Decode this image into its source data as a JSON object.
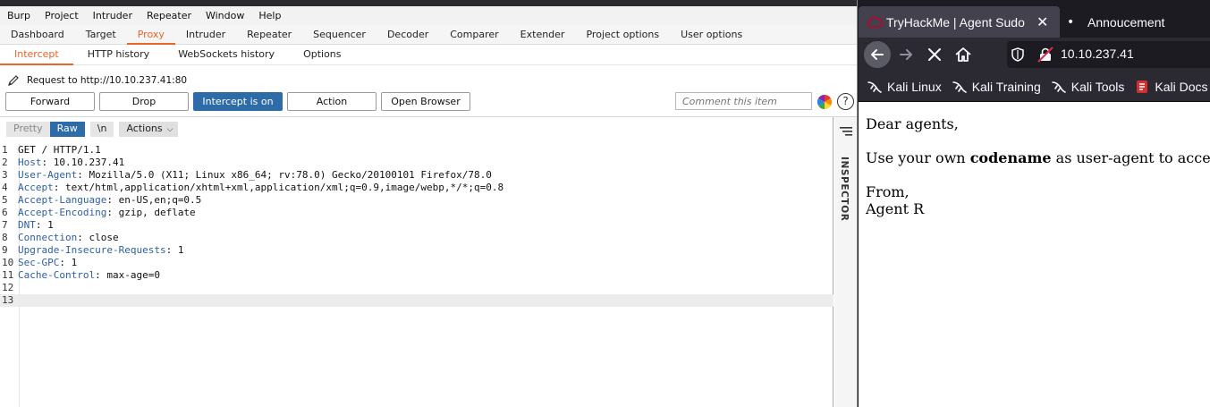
{
  "burp": {
    "menu": [
      "Burp",
      "Project",
      "Intruder",
      "Repeater",
      "Window",
      "Help"
    ],
    "main_tabs": [
      "Dashboard",
      "Target",
      "Proxy",
      "Intruder",
      "Repeater",
      "Sequencer",
      "Decoder",
      "Comparer",
      "Extender",
      "Project options",
      "User options"
    ],
    "active_main_tab": "Proxy",
    "proxy_tabs": [
      "Intercept",
      "HTTP history",
      "WebSockets history",
      "Options"
    ],
    "active_proxy_tab": "Intercept",
    "request_info": "Request to http://10.10.237.41:80",
    "buttons": {
      "forward": "Forward",
      "drop": "Drop",
      "intercept": "Intercept is on",
      "action": "Action",
      "open_browser": "Open Browser"
    },
    "comment_placeholder": "Comment this item",
    "help": "?",
    "editor_toolbar": {
      "pretty": "Pretty",
      "raw": "Raw",
      "newline": "\\n",
      "actions": "Actions"
    },
    "request_lines": [
      {
        "num": "1",
        "name": "",
        "text": "GET / HTTP/1.1"
      },
      {
        "num": "2",
        "name": "Host",
        "text": ": 10.10.237.41"
      },
      {
        "num": "3",
        "name": "User-Agent",
        "text": ": Mozilla/5.0 (X11; Linux x86_64; rv:78.0) Gecko/20100101 Firefox/78.0"
      },
      {
        "num": "4",
        "name": "Accept",
        "text": ": text/html,application/xhtml+xml,application/xml;q=0.9,image/webp,*/*;q=0.8"
      },
      {
        "num": "5",
        "name": "Accept-Language",
        "text": ": en-US,en;q=0.5"
      },
      {
        "num": "6",
        "name": "Accept-Encoding",
        "text": ": gzip, deflate"
      },
      {
        "num": "7",
        "name": "DNT",
        "text": ": 1"
      },
      {
        "num": "8",
        "name": "Connection",
        "text": ": close"
      },
      {
        "num": "9",
        "name": "Upgrade-Insecure-Requests",
        "text": ": 1"
      },
      {
        "num": "10",
        "name": "Sec-GPC",
        "text": ": 1"
      },
      {
        "num": "11",
        "name": "Cache-Control",
        "text": ": max-age=0"
      },
      {
        "num": "12",
        "name": "",
        "text": ""
      },
      {
        "num": "13",
        "name": "",
        "text": ""
      }
    ],
    "inspector_label": "INSPECTOR"
  },
  "firefox": {
    "tabs": [
      {
        "title": "TryHackMe | Agent Sudo",
        "close": "✕"
      },
      {
        "title": "Annoucement",
        "dot": "•"
      }
    ],
    "url": "10.10.237.41",
    "bookmarks": [
      "Kali Linux",
      "Kali Training",
      "Kali Tools",
      "Kali Docs"
    ],
    "page": {
      "greeting": "Dear agents,",
      "line_pre": "Use your own ",
      "line_bold": "codename",
      "line_post": " as user-agent to access the site.",
      "from": "From,",
      "signature": "Agent R"
    }
  },
  "colors": {
    "burp_accent": "#e8652c",
    "burp_button_on": "#2e6ca8",
    "header_name": "#2b5fa8",
    "ff_dark": "#1c1b22",
    "ff_toolbar": "#2b2a33"
  }
}
